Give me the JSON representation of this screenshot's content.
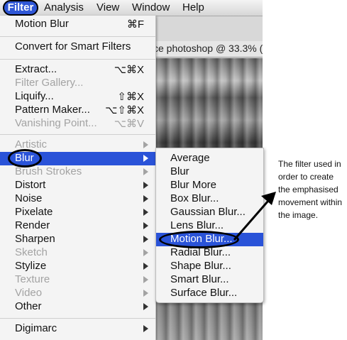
{
  "menubar": {
    "filter": "Filter",
    "analysis": "Analysis",
    "view": "View",
    "window": "Window",
    "help": "Help"
  },
  "document_tab": "ce photoshop @ 33.3% (",
  "filter_menu": {
    "items": [
      {
        "label": "Motion Blur",
        "shortcut": "⌘F"
      },
      {
        "label": "Convert for Smart Filters"
      },
      {
        "label": "Extract...",
        "shortcut": "⌥⌘X"
      },
      {
        "label": "Filter Gallery..."
      },
      {
        "label": "Liquify...",
        "shortcut": "⇧⌘X"
      },
      {
        "label": "Pattern Maker...",
        "shortcut": "⌥⇧⌘X"
      },
      {
        "label": "Vanishing Point...",
        "shortcut": "⌥⌘V"
      },
      {
        "label": "Artistic"
      },
      {
        "label": "Blur"
      },
      {
        "label": "Brush Strokes"
      },
      {
        "label": "Distort"
      },
      {
        "label": "Noise"
      },
      {
        "label": "Pixelate"
      },
      {
        "label": "Render"
      },
      {
        "label": "Sharpen"
      },
      {
        "label": "Sketch"
      },
      {
        "label": "Stylize"
      },
      {
        "label": "Texture"
      },
      {
        "label": "Video"
      },
      {
        "label": "Other"
      },
      {
        "label": "Digimarc"
      }
    ]
  },
  "blur_submenu": {
    "items": [
      {
        "label": "Average"
      },
      {
        "label": "Blur"
      },
      {
        "label": "Blur More"
      },
      {
        "label": "Box Blur..."
      },
      {
        "label": "Gaussian Blur..."
      },
      {
        "label": "Lens Blur..."
      },
      {
        "label": "Motion Blur..."
      },
      {
        "label": "Radial Blur..."
      },
      {
        "label": "Shape Blur..."
      },
      {
        "label": "Smart Blur..."
      },
      {
        "label": "Surface Blur..."
      }
    ]
  },
  "annotation": {
    "text": "The filter used in order to create the emphasised movement within the image."
  },
  "colors": {
    "highlight": "#2a53d8",
    "disabled_text": "#a3a3a3"
  }
}
